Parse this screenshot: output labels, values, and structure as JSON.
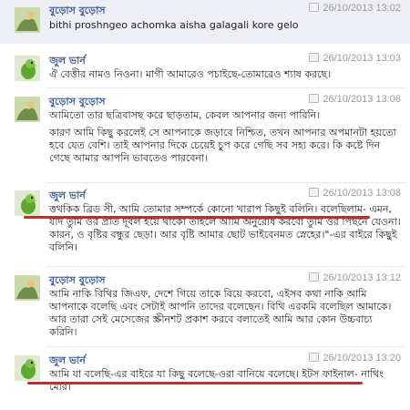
{
  "messages": [
    {
      "sender": "বুড়োস বুড়োস",
      "time": "26/10/2013 13:02",
      "paragraphs": [
        "bithi proshngeo achomka aisha galagali kore gelo"
      ]
    },
    {
      "sender": "জুল ভার্ন",
      "time": "26/10/2013 13:03",
      "paragraphs": [
        "ঐ বেত্তীর নামও নিওনা। মাগী আমারেও পচাইছে-তোমারেও শ্যাষ করছে।"
      ]
    },
    {
      "sender": "বুড়োস বুড়োস",
      "time": "26/10/2013 13:06",
      "paragraphs": [
        "আমিতো তার ছত্রিবাসছ করে ছাড়তাম, কেবল আপনার জন্য পারিনি।",
        "কারণ আমি কিছু করলেই সে আপনাকে জড়াবে নিশ্চিত, তখন আপনার অপমানটা হয়তো হবে যেত বেশি। তাই আপনার দিকে চেয়েই চুপ করে গেছি সব সহ্য করে। কি কষ্টে দিন গেছে আমার আপনি ভাবতেও পারবেনা।"
      ]
    },
    {
      "sender": "জুল ভার্ন",
      "time": "26/10/2013 13:08",
      "paragraphs": [
        "ত্তথকিক ব্রিড সী, আমি তোমার সম্পর্কে কোনো খারাপ কিছুই বলিনি। বলেছিলাম- এমন, যদি তুমি ওর প্রতি দূর্বল হয়ে থাকো তাহলে আমি অনুরোধ করবো তুমি ওর পিছনে যেওনা। কারন, ও বৃষ্টির বন্ধুর ছেড়া। আর বৃষ্টি আমার ছোট ভাইবেনমত স্নেহের।\"-এর বাইরে কিছুই বলিনি।"
      ]
    },
    {
      "sender": "বুড়োস বুড়োস",
      "time": "26/10/2013 13:12",
      "paragraphs": [
        "আমি নাকি বিথির জিএফ, দেশে গিয়ে তাকে বিয়ে করবো, এইসব কথা নাকি আমি আপনাকে বলেছি এবং সেটাই আপনি তাদের বলেছেন। বিথি এরকমি বলেছিল আমাকে। আর তারা সেই মেসেজের স্ক্রীনশট প্রকাশ করবে বলাতেই আমি আর কোন উচ্চবাচ্য করিনি।"
      ]
    },
    {
      "sender": "জুল ভার্ন",
      "time": "26/10/2013 13:20",
      "paragraphs": [
        "আমি যা বলেছি-এর বাইরে যা কিছু বলেছে-ওরা বানিয়ে বলেছে। ইটস ফাইনাল- নাথিং মোর।"
      ]
    }
  ]
}
